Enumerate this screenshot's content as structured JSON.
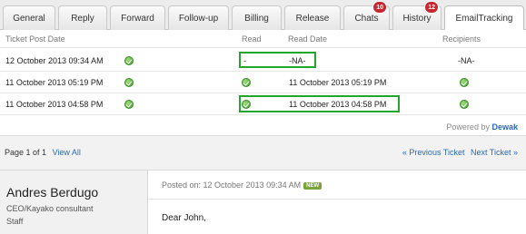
{
  "tabs": [
    {
      "label": "General"
    },
    {
      "label": "Reply"
    },
    {
      "label": "Forward"
    },
    {
      "label": "Follow-up"
    },
    {
      "label": "Billing"
    },
    {
      "label": "Release"
    },
    {
      "label": "Chats",
      "badge": "10"
    },
    {
      "label": "History",
      "badge": "12"
    },
    {
      "label": "EmailTracking",
      "active": true
    }
  ],
  "table": {
    "headers": {
      "ticket_post_date": "Ticket Post Date",
      "read": "Read",
      "read_date": "Read Date",
      "recipients": "Recipients"
    },
    "rows": [
      {
        "post_date": "12 October 2013 09:34 AM",
        "read": "-",
        "read_date": "-NA-",
        "recipients": "-NA-"
      },
      {
        "post_date": "11 October 2013 05:19 PM",
        "read": "check-icon",
        "read_date": "11 October 2013 05:19 PM",
        "recipients": "check-icon"
      },
      {
        "post_date": "11 October 2013 04:58 PM",
        "read": "check-icon",
        "read_date": "11 October 2013 04:58 PM",
        "recipients": "check-icon"
      }
    ],
    "powered_prefix": "Powered by",
    "powered_brand": "Dewak"
  },
  "pager": {
    "page_text": "Page 1 of 1",
    "view_all": "View All",
    "prev": "« Previous Ticket",
    "next": "Next Ticket »"
  },
  "post": {
    "author_name": "Andres Berdugo",
    "author_role": "CEO/Kayako consultant",
    "author_type": "Staff",
    "posted_on": "Posted on: 12 October 2013 09:34 AM",
    "new_badge": "NEW",
    "body": "Dear John,"
  },
  "colors": {
    "highlight": "#24a52e",
    "badge": "#c7272e",
    "link": "#2a6ab5",
    "check": "#3f9e2a"
  }
}
